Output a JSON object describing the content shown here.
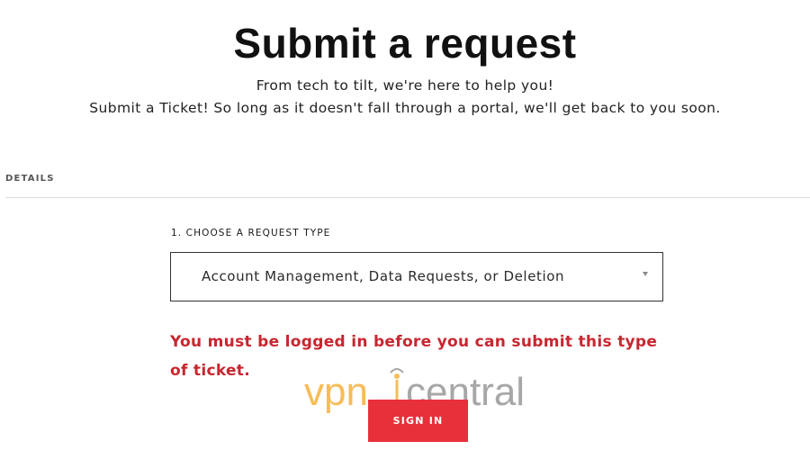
{
  "header": {
    "title": "Submit a request",
    "subtitle_line1": "From tech to tilt, we're here to help you!",
    "subtitle_line2": "Submit a Ticket! So long as it doesn't fall through a portal, we'll get back to you soon."
  },
  "details": {
    "section_label": "DETAILS"
  },
  "request_type": {
    "label": "1. CHOOSE A REQUEST TYPE",
    "selected_value": "Account Management, Data Requests, or Deletion",
    "arrow_icon": "caret-down-icon"
  },
  "error": {
    "message_line1": "You must be logged in before you can submit this type",
    "message_line2": "of ticket."
  },
  "signin": {
    "label": "SIGN IN",
    "color": "#e8303a"
  },
  "watermark": {
    "text_part1": "vpn",
    "text_part2": "central",
    "accent_color": "#f5a623",
    "gray_color": "#8a8a8a"
  },
  "colors": {
    "error": "#c8262f",
    "button": "#e8303a"
  }
}
